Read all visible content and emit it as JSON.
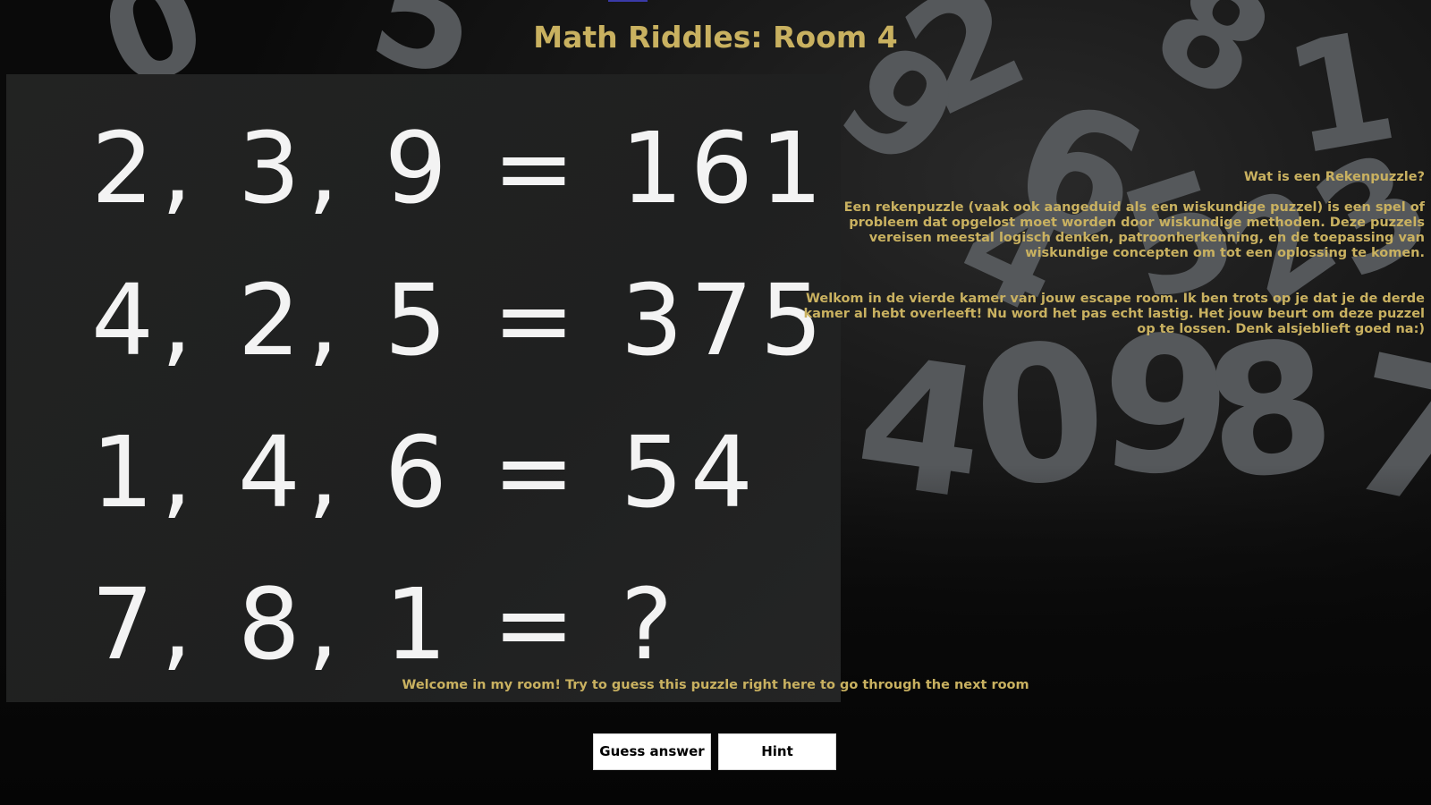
{
  "page": {
    "title": "Math Riddles: Room 4"
  },
  "colors": {
    "accent_gold": "#c9b160",
    "board_bg": "#222322",
    "page_bg": "#0c0c0c",
    "button_bg": "#ffffff"
  },
  "puzzle": {
    "equations": [
      "2, 3, 9 = 161",
      "4, 2, 5 = 375",
      "1, 4, 6 = 54",
      "7, 8, 1 = ?"
    ]
  },
  "background_digits": [
    "0",
    "5",
    "2",
    "8",
    "1",
    "6",
    "4",
    "0",
    "9",
    "8",
    "7",
    "3",
    "9",
    "5",
    "4",
    "2"
  ],
  "info": {
    "heading": "Wat is een Rekenpuzzle?",
    "text": "Een rekenpuzzle (vaak ook aangeduid als een wiskundige puzzel) is een spel of probleem dat opgelost moet worden door wiskundige methoden. Deze puzzels vereisen meestal logisch denken, patroonherkenning, en de toepassing van wiskundige concepten om tot een oplossing te komen.",
    "welcome_nl": "Welkom in de vierde kamer van jouw escape room. Ik ben trots op je dat je de derde kamer al hebt overleeft! Nu word het pas echt lastig. Het jouw beurt om deze puzzel op te lossen. Denk alsjeblieft goed na:)"
  },
  "welcome_en": "Welcome in my room! Try to guess this puzzle right here to go through the next room",
  "buttons": {
    "guess": "Guess answer",
    "hint": "Hint"
  }
}
